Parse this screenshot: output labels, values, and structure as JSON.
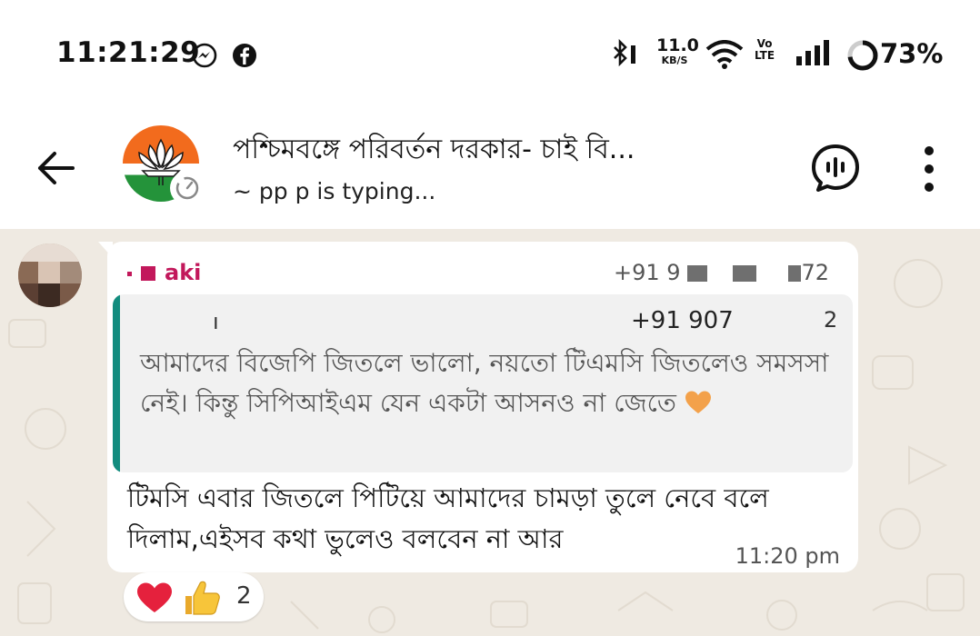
{
  "status_bar": {
    "time": "11:21:29",
    "net_speed_value": "11.0",
    "net_speed_unit": "KB/S",
    "volte_top": "Vo",
    "volte_bottom": "LTE",
    "battery_percent": "73%",
    "battery_level": 0.73,
    "icons": [
      "messenger-icon",
      "facebook-icon",
      "bluetooth-icon",
      "wifi-icon",
      "signal-icon",
      "battery-icon"
    ]
  },
  "header": {
    "group_name": "পশ্চিমবঙ্গে পরিবর্তন দরকার- চাই বি...",
    "typing_status": "~ pp p is typing..."
  },
  "message": {
    "sender_name": "aki",
    "sender_phone_prefix": "+91 9",
    "sender_phone_suffix": "72",
    "quote": {
      "sender_marker": "ı",
      "phone": "+91 907",
      "phone_tail": "2",
      "text": "আমাদের বিজেপি জিতলে ভালো, নয়তো টিএমসি জিতলেও সমসসা নেই। কিন্তু সিপিআইএম যেন একটা আসনও না জেতে"
    },
    "text": "টিমসি এবার জিতলে পিটিয়ে আমাদের চামড়া তুলে নেবে বলে দিলাম,এইসব কথা ভুলেও বলবেন না আর",
    "time": "11:20 pm",
    "reactions_count": "2"
  },
  "colors": {
    "chat_background": "#efeae2",
    "quote_bar": "#128c7e",
    "sender_name": "#c2185b",
    "bjp_saffron": "#f26b1d",
    "bjp_green": "#24933a"
  }
}
